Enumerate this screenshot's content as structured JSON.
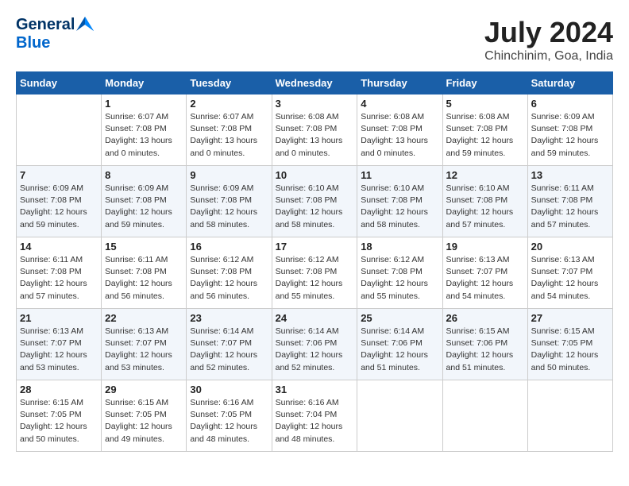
{
  "header": {
    "logo_general": "General",
    "logo_blue": "Blue",
    "month_year": "July 2024",
    "location": "Chinchinim, Goa, India"
  },
  "calendar": {
    "days_of_week": [
      "Sunday",
      "Monday",
      "Tuesday",
      "Wednesday",
      "Thursday",
      "Friday",
      "Saturday"
    ],
    "weeks": [
      [
        {
          "day": "",
          "details": ""
        },
        {
          "day": "1",
          "details": "Sunrise: 6:07 AM\nSunset: 7:08 PM\nDaylight: 13 hours\nand 0 minutes."
        },
        {
          "day": "2",
          "details": "Sunrise: 6:07 AM\nSunset: 7:08 PM\nDaylight: 13 hours\nand 0 minutes."
        },
        {
          "day": "3",
          "details": "Sunrise: 6:08 AM\nSunset: 7:08 PM\nDaylight: 13 hours\nand 0 minutes."
        },
        {
          "day": "4",
          "details": "Sunrise: 6:08 AM\nSunset: 7:08 PM\nDaylight: 13 hours\nand 0 minutes."
        },
        {
          "day": "5",
          "details": "Sunrise: 6:08 AM\nSunset: 7:08 PM\nDaylight: 12 hours\nand 59 minutes."
        },
        {
          "day": "6",
          "details": "Sunrise: 6:09 AM\nSunset: 7:08 PM\nDaylight: 12 hours\nand 59 minutes."
        }
      ],
      [
        {
          "day": "7",
          "details": "Sunrise: 6:09 AM\nSunset: 7:08 PM\nDaylight: 12 hours\nand 59 minutes."
        },
        {
          "day": "8",
          "details": "Sunrise: 6:09 AM\nSunset: 7:08 PM\nDaylight: 12 hours\nand 59 minutes."
        },
        {
          "day": "9",
          "details": "Sunrise: 6:09 AM\nSunset: 7:08 PM\nDaylight: 12 hours\nand 58 minutes."
        },
        {
          "day": "10",
          "details": "Sunrise: 6:10 AM\nSunset: 7:08 PM\nDaylight: 12 hours\nand 58 minutes."
        },
        {
          "day": "11",
          "details": "Sunrise: 6:10 AM\nSunset: 7:08 PM\nDaylight: 12 hours\nand 58 minutes."
        },
        {
          "day": "12",
          "details": "Sunrise: 6:10 AM\nSunset: 7:08 PM\nDaylight: 12 hours\nand 57 minutes."
        },
        {
          "day": "13",
          "details": "Sunrise: 6:11 AM\nSunset: 7:08 PM\nDaylight: 12 hours\nand 57 minutes."
        }
      ],
      [
        {
          "day": "14",
          "details": "Sunrise: 6:11 AM\nSunset: 7:08 PM\nDaylight: 12 hours\nand 57 minutes."
        },
        {
          "day": "15",
          "details": "Sunrise: 6:11 AM\nSunset: 7:08 PM\nDaylight: 12 hours\nand 56 minutes."
        },
        {
          "day": "16",
          "details": "Sunrise: 6:12 AM\nSunset: 7:08 PM\nDaylight: 12 hours\nand 56 minutes."
        },
        {
          "day": "17",
          "details": "Sunrise: 6:12 AM\nSunset: 7:08 PM\nDaylight: 12 hours\nand 55 minutes."
        },
        {
          "day": "18",
          "details": "Sunrise: 6:12 AM\nSunset: 7:08 PM\nDaylight: 12 hours\nand 55 minutes."
        },
        {
          "day": "19",
          "details": "Sunrise: 6:13 AM\nSunset: 7:07 PM\nDaylight: 12 hours\nand 54 minutes."
        },
        {
          "day": "20",
          "details": "Sunrise: 6:13 AM\nSunset: 7:07 PM\nDaylight: 12 hours\nand 54 minutes."
        }
      ],
      [
        {
          "day": "21",
          "details": "Sunrise: 6:13 AM\nSunset: 7:07 PM\nDaylight: 12 hours\nand 53 minutes."
        },
        {
          "day": "22",
          "details": "Sunrise: 6:13 AM\nSunset: 7:07 PM\nDaylight: 12 hours\nand 53 minutes."
        },
        {
          "day": "23",
          "details": "Sunrise: 6:14 AM\nSunset: 7:07 PM\nDaylight: 12 hours\nand 52 minutes."
        },
        {
          "day": "24",
          "details": "Sunrise: 6:14 AM\nSunset: 7:06 PM\nDaylight: 12 hours\nand 52 minutes."
        },
        {
          "day": "25",
          "details": "Sunrise: 6:14 AM\nSunset: 7:06 PM\nDaylight: 12 hours\nand 51 minutes."
        },
        {
          "day": "26",
          "details": "Sunrise: 6:15 AM\nSunset: 7:06 PM\nDaylight: 12 hours\nand 51 minutes."
        },
        {
          "day": "27",
          "details": "Sunrise: 6:15 AM\nSunset: 7:05 PM\nDaylight: 12 hours\nand 50 minutes."
        }
      ],
      [
        {
          "day": "28",
          "details": "Sunrise: 6:15 AM\nSunset: 7:05 PM\nDaylight: 12 hours\nand 50 minutes."
        },
        {
          "day": "29",
          "details": "Sunrise: 6:15 AM\nSunset: 7:05 PM\nDaylight: 12 hours\nand 49 minutes."
        },
        {
          "day": "30",
          "details": "Sunrise: 6:16 AM\nSunset: 7:05 PM\nDaylight: 12 hours\nand 48 minutes."
        },
        {
          "day": "31",
          "details": "Sunrise: 6:16 AM\nSunset: 7:04 PM\nDaylight: 12 hours\nand 48 minutes."
        },
        {
          "day": "",
          "details": ""
        },
        {
          "day": "",
          "details": ""
        },
        {
          "day": "",
          "details": ""
        }
      ]
    ]
  }
}
